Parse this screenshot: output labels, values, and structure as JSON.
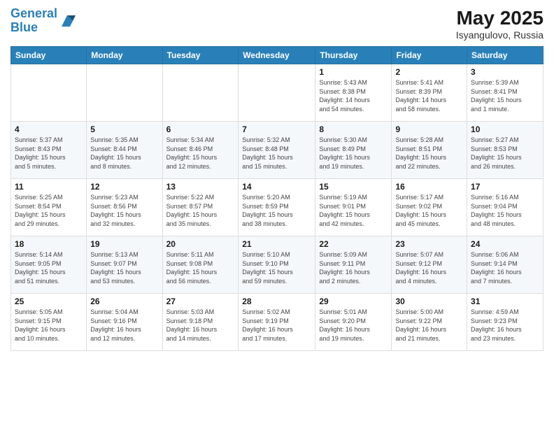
{
  "logo": {
    "line1": "General",
    "line2": "Blue"
  },
  "title": "May 2025",
  "subtitle": "Isyangulovo, Russia",
  "days_of_week": [
    "Sunday",
    "Monday",
    "Tuesday",
    "Wednesday",
    "Thursday",
    "Friday",
    "Saturday"
  ],
  "weeks": [
    [
      {
        "day": "",
        "info": ""
      },
      {
        "day": "",
        "info": ""
      },
      {
        "day": "",
        "info": ""
      },
      {
        "day": "",
        "info": ""
      },
      {
        "day": "1",
        "info": "Sunrise: 5:43 AM\nSunset: 8:38 PM\nDaylight: 14 hours\nand 54 minutes."
      },
      {
        "day": "2",
        "info": "Sunrise: 5:41 AM\nSunset: 8:39 PM\nDaylight: 14 hours\nand 58 minutes."
      },
      {
        "day": "3",
        "info": "Sunrise: 5:39 AM\nSunset: 8:41 PM\nDaylight: 15 hours\nand 1 minute."
      }
    ],
    [
      {
        "day": "4",
        "info": "Sunrise: 5:37 AM\nSunset: 8:43 PM\nDaylight: 15 hours\nand 5 minutes."
      },
      {
        "day": "5",
        "info": "Sunrise: 5:35 AM\nSunset: 8:44 PM\nDaylight: 15 hours\nand 8 minutes."
      },
      {
        "day": "6",
        "info": "Sunrise: 5:34 AM\nSunset: 8:46 PM\nDaylight: 15 hours\nand 12 minutes."
      },
      {
        "day": "7",
        "info": "Sunrise: 5:32 AM\nSunset: 8:48 PM\nDaylight: 15 hours\nand 15 minutes."
      },
      {
        "day": "8",
        "info": "Sunrise: 5:30 AM\nSunset: 8:49 PM\nDaylight: 15 hours\nand 19 minutes."
      },
      {
        "day": "9",
        "info": "Sunrise: 5:28 AM\nSunset: 8:51 PM\nDaylight: 15 hours\nand 22 minutes."
      },
      {
        "day": "10",
        "info": "Sunrise: 5:27 AM\nSunset: 8:53 PM\nDaylight: 15 hours\nand 26 minutes."
      }
    ],
    [
      {
        "day": "11",
        "info": "Sunrise: 5:25 AM\nSunset: 8:54 PM\nDaylight: 15 hours\nand 29 minutes."
      },
      {
        "day": "12",
        "info": "Sunrise: 5:23 AM\nSunset: 8:56 PM\nDaylight: 15 hours\nand 32 minutes."
      },
      {
        "day": "13",
        "info": "Sunrise: 5:22 AM\nSunset: 8:57 PM\nDaylight: 15 hours\nand 35 minutes."
      },
      {
        "day": "14",
        "info": "Sunrise: 5:20 AM\nSunset: 8:59 PM\nDaylight: 15 hours\nand 38 minutes."
      },
      {
        "day": "15",
        "info": "Sunrise: 5:19 AM\nSunset: 9:01 PM\nDaylight: 15 hours\nand 42 minutes."
      },
      {
        "day": "16",
        "info": "Sunrise: 5:17 AM\nSunset: 9:02 PM\nDaylight: 15 hours\nand 45 minutes."
      },
      {
        "day": "17",
        "info": "Sunrise: 5:16 AM\nSunset: 9:04 PM\nDaylight: 15 hours\nand 48 minutes."
      }
    ],
    [
      {
        "day": "18",
        "info": "Sunrise: 5:14 AM\nSunset: 9:05 PM\nDaylight: 15 hours\nand 51 minutes."
      },
      {
        "day": "19",
        "info": "Sunrise: 5:13 AM\nSunset: 9:07 PM\nDaylight: 15 hours\nand 53 minutes."
      },
      {
        "day": "20",
        "info": "Sunrise: 5:11 AM\nSunset: 9:08 PM\nDaylight: 15 hours\nand 56 minutes."
      },
      {
        "day": "21",
        "info": "Sunrise: 5:10 AM\nSunset: 9:10 PM\nDaylight: 15 hours\nand 59 minutes."
      },
      {
        "day": "22",
        "info": "Sunrise: 5:09 AM\nSunset: 9:11 PM\nDaylight: 16 hours\nand 2 minutes."
      },
      {
        "day": "23",
        "info": "Sunrise: 5:07 AM\nSunset: 9:12 PM\nDaylight: 16 hours\nand 4 minutes."
      },
      {
        "day": "24",
        "info": "Sunrise: 5:06 AM\nSunset: 9:14 PM\nDaylight: 16 hours\nand 7 minutes."
      }
    ],
    [
      {
        "day": "25",
        "info": "Sunrise: 5:05 AM\nSunset: 9:15 PM\nDaylight: 16 hours\nand 10 minutes."
      },
      {
        "day": "26",
        "info": "Sunrise: 5:04 AM\nSunset: 9:16 PM\nDaylight: 16 hours\nand 12 minutes."
      },
      {
        "day": "27",
        "info": "Sunrise: 5:03 AM\nSunset: 9:18 PM\nDaylight: 16 hours\nand 14 minutes."
      },
      {
        "day": "28",
        "info": "Sunrise: 5:02 AM\nSunset: 9:19 PM\nDaylight: 16 hours\nand 17 minutes."
      },
      {
        "day": "29",
        "info": "Sunrise: 5:01 AM\nSunset: 9:20 PM\nDaylight: 16 hours\nand 19 minutes."
      },
      {
        "day": "30",
        "info": "Sunrise: 5:00 AM\nSunset: 9:22 PM\nDaylight: 16 hours\nand 21 minutes."
      },
      {
        "day": "31",
        "info": "Sunrise: 4:59 AM\nSunset: 9:23 PM\nDaylight: 16 hours\nand 23 minutes."
      }
    ]
  ]
}
